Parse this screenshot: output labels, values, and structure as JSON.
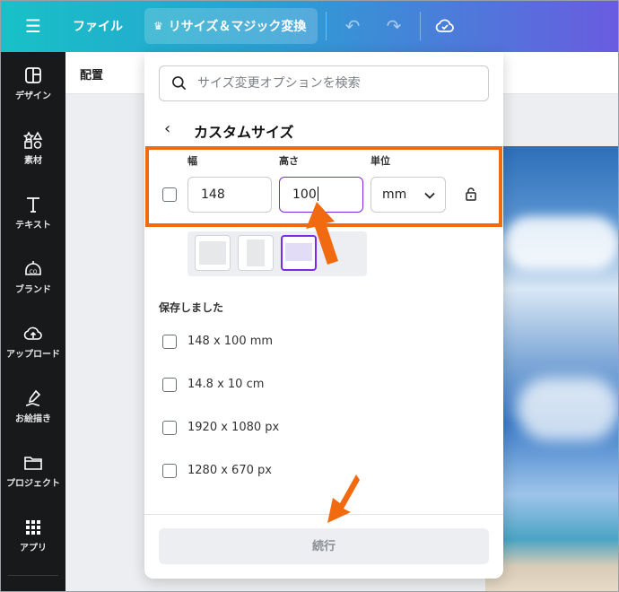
{
  "topbar": {
    "menu_icon": "hamburger-icon",
    "file_label": "ファイル",
    "resize_label": "リサイズ＆マジック変換",
    "crown_icon": "crown-icon",
    "undo_icon": "undo-icon",
    "redo_icon": "redo-icon",
    "save_icon": "cloud-check-icon"
  },
  "sidebar": {
    "items": [
      {
        "label": "デザイン",
        "icon": "design-icon"
      },
      {
        "label": "素材",
        "icon": "elements-icon"
      },
      {
        "label": "テキスト",
        "icon": "text-icon"
      },
      {
        "label": "ブランド",
        "icon": "brand-icon"
      },
      {
        "label": "アップロード",
        "icon": "upload-icon"
      },
      {
        "label": "お絵描き",
        "icon": "draw-icon"
      },
      {
        "label": "プロジェクト",
        "icon": "folder-icon"
      },
      {
        "label": "アプリ",
        "icon": "apps-icon"
      }
    ]
  },
  "subbar": {
    "label": "配置"
  },
  "panel": {
    "search_placeholder": "サイズ変更オプションを検索",
    "title": "カスタムサイズ",
    "width_label": "幅",
    "height_label": "高さ",
    "unit_label": "単位",
    "width_value": "148",
    "height_value": "100",
    "unit_value": "mm",
    "lock_icon": "lock-icon",
    "saved_title": "保存しました",
    "saved_items": [
      "148 x 100 mm",
      "14.8 x 10 cm",
      "1920 x 1080 px",
      "1280 x 670 px"
    ],
    "continue_label": "続行"
  },
  "colors": {
    "accent": "#7d2ae8",
    "highlight": "#f26a10",
    "sidebar": "#18191b"
  }
}
